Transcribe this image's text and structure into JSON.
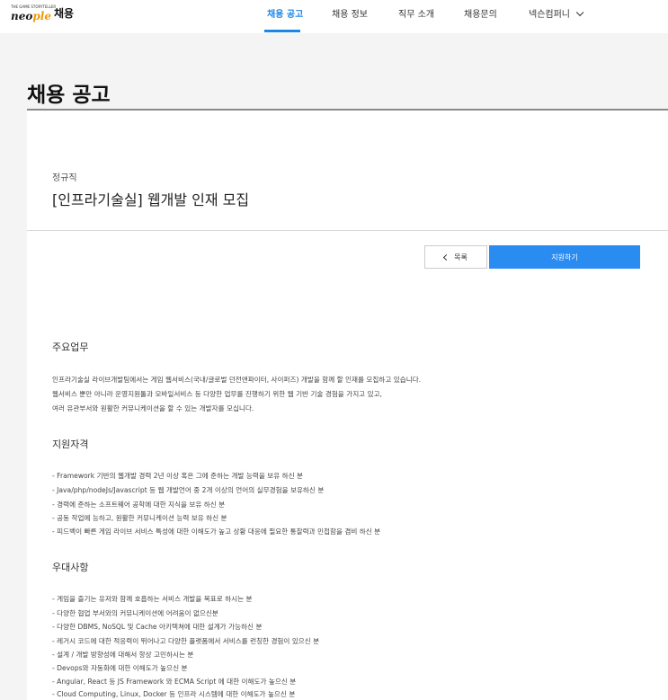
{
  "header": {
    "logo_small": "THE GAME STORYTELLER",
    "logo_main_a": "neo",
    "logo_main_b": "ple",
    "brand": "채용",
    "nav": [
      {
        "label": "채용 공고",
        "active": true
      },
      {
        "label": "채용 정보",
        "active": false
      },
      {
        "label": "직무 소개",
        "active": false
      },
      {
        "label": "채용문의",
        "active": false
      },
      {
        "label": "넥슨컴퍼니",
        "active": false
      }
    ]
  },
  "page": {
    "title": "채용 공고"
  },
  "job": {
    "type": "정규직",
    "title": "[인프라기술실] 웹개발 인재 모집",
    "buttons": {
      "list": "목록",
      "apply": "지원하기"
    },
    "sections": [
      {
        "heading": "주요업무",
        "lines": [
          "인프라기술실 라이브개발팀에서는 게임 웹서비스(국내/글로벌 던전앤파이터, 사이퍼즈) 개발을 함께 할 인재를 모집하고 있습니다.",
          "웹서비스 뿐만 아니라 운영지원툴과 모바일서비스 등 다양한 업무를 진행하기 위한 웹 기반 기술 경험을 가지고 있고,",
          "여러 유관부서와 원활한 커뮤니케이션을 할 수 있는 개발자를 모십니다."
        ]
      },
      {
        "heading": "지원자격",
        "lines": [
          "- Framework 기반의 웹개발 경력 2년 이상 혹은 그에 준하는 개발 능력을 보유 하신 분",
          "- Java/php/nodeJs/Javascript 등 웹 개발언어 중 2개 이상의 언어의 실무경험을 보유하신 분",
          "- 경력에 준하는 소프트웨어 공학에 대한 지식을 보유 하신 분",
          "- 공동 작업에 능하고, 원활한 커뮤니케이션 능력 보유 하신 분",
          "- 피드백이 빠른 게임 라이브 서비스 특성에 대한 이해도가 높고 상황 대응에 필요한 통찰력과 민첩함을 겸비 하신 분"
        ]
      },
      {
        "heading": "우대사항",
        "lines": [
          "- 게임을 즐기는 유저와 함께 호흡하는 서비스 개발을 목표로 하시는 분",
          "- 다양한 협업 부서와의 커뮤니케이션에 어려움이 없으신분",
          "- 다양한 DBMS, NoSQL 및 Cache 아키텍쳐에 대한 설계가 가능하신 분",
          "- 레거시 코드에 대한 적응력이 뛰어나고 다양한 플랫폼에서 서비스를 런칭한 경험이 있으신 분",
          "- 설계 / 개발 방향성에 대해서 항상 고민하시는 분",
          "- Devops와 자동화에 대한 이해도가 높으신 분",
          "- Angular, React 등 JS Framework 와 ECMA Script 에 대한 이해도가 높으신 분",
          "- Cloud Computing, Linux, Docker 등 인프라 시스템에 대한 이해도가 높으신 분"
        ]
      }
    ]
  }
}
